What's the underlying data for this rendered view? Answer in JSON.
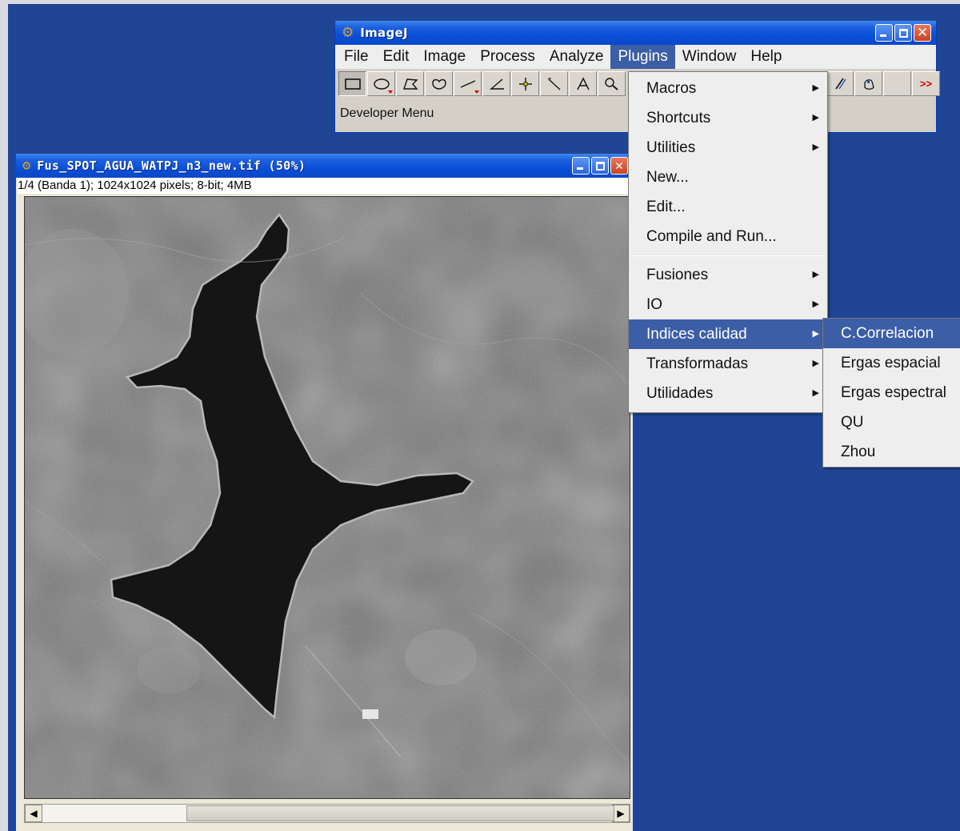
{
  "main_window": {
    "title": "ImageJ",
    "menubar": [
      "File",
      "Edit",
      "Image",
      "Process",
      "Analyze",
      "Plugins",
      "Window",
      "Help"
    ],
    "active_menu": "Plugins",
    "toolbar_more": ">>",
    "status": "Developer Menu"
  },
  "image_window": {
    "title": "Fus_SPOT_AGUA_WATPJ_n3_new.tif (50%)",
    "info": "1/4 (Banda 1); 1024x1024 pixels; 8-bit; 4MB"
  },
  "plugins_menu": {
    "group1": [
      "Macros",
      "Shortcuts",
      "Utilities",
      "New...",
      "Edit...",
      "Compile and Run..."
    ],
    "group2": [
      "Fusiones",
      "IO",
      "Indices calidad",
      "Transformadas",
      "Utilidades"
    ],
    "highlighted": "Indices calidad"
  },
  "indices_submenu": [
    "C.Correlacion",
    "Ergas espacial",
    "Ergas espectral",
    "QU",
    "Zhou"
  ],
  "colors": {
    "desktop": "#204594",
    "highlight": "#3c5ea6",
    "menu_bg": "#eeeeee"
  }
}
